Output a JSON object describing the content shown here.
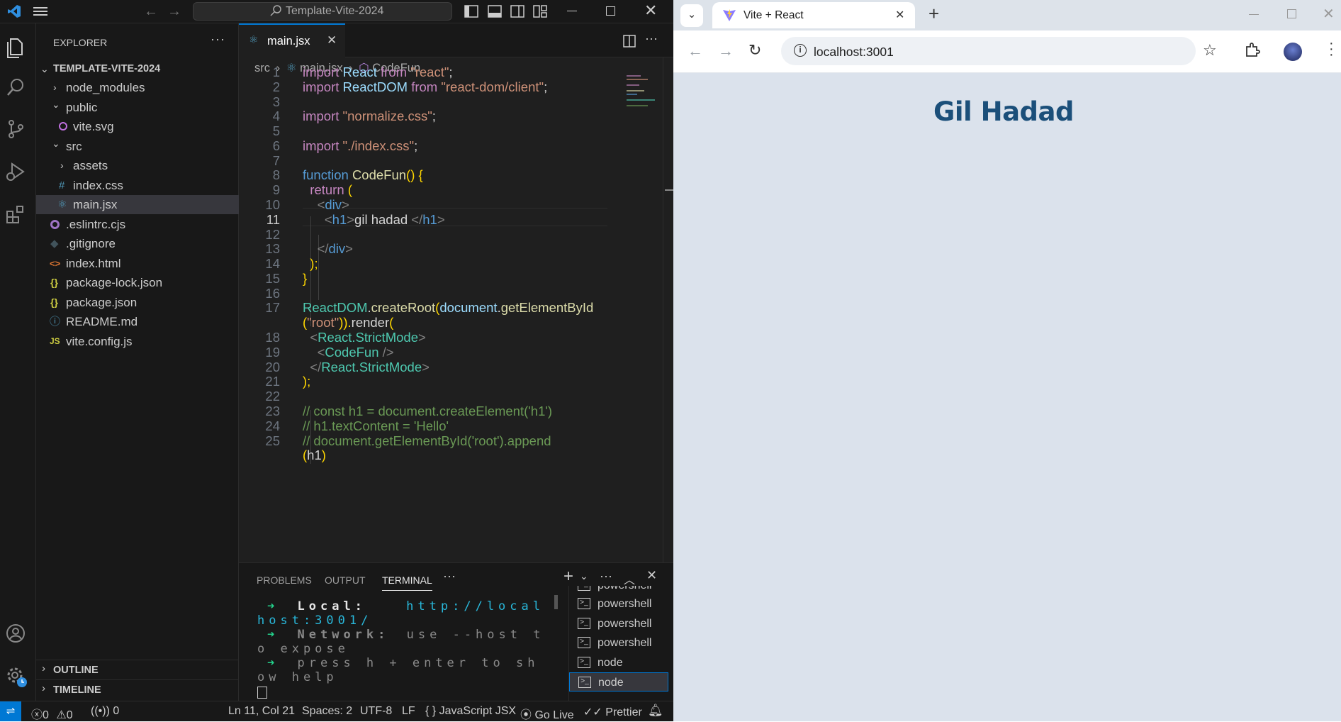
{
  "vscode": {
    "search_box": "Template-Vite-2024",
    "explorer": {
      "title": "EXPLORER",
      "project": "TEMPLATE-VITE-2024",
      "items": [
        {
          "label": "node_modules",
          "icon": "chevron-right-icon"
        },
        {
          "label": "public",
          "icon": "chevron-down-icon"
        },
        {
          "label": "vite.svg",
          "icon": "svg-file-icon"
        },
        {
          "label": "src",
          "icon": "chevron-down-icon"
        },
        {
          "label": "assets",
          "icon": "chevron-right-icon"
        },
        {
          "label": "index.css",
          "icon": "css-file-icon",
          "glyph": "#"
        },
        {
          "label": "main.jsx",
          "icon": "react-file-icon",
          "selected": true
        },
        {
          "label": ".eslintrc.cjs",
          "icon": "eslint-file-icon"
        },
        {
          "label": ".gitignore",
          "icon": "git-file-icon"
        },
        {
          "label": "index.html",
          "icon": "html-file-icon",
          "glyph": "<>"
        },
        {
          "label": "package-lock.json",
          "icon": "json-file-icon",
          "glyph": "{}"
        },
        {
          "label": "package.json",
          "icon": "json-file-icon",
          "glyph": "{}"
        },
        {
          "label": "README.md",
          "icon": "info-file-icon",
          "glyph": "ⓘ"
        },
        {
          "label": "vite.config.js",
          "icon": "js-file-icon",
          "glyph": "JS"
        }
      ],
      "outline": "OUTLINE",
      "timeline": "TIMELINE"
    },
    "tab": {
      "label": "main.jsx"
    },
    "breadcrumb": {
      "src": "src",
      "file": "main.jsx",
      "symbol": "CodeFun"
    },
    "code": [
      {
        "n": "1",
        "text": "import React from \"react\";"
      },
      {
        "n": "2",
        "text": "import ReactDOM from \"react-dom/client\";"
      },
      {
        "n": "3",
        "text": ""
      },
      {
        "n": "4",
        "text": "import \"normalize.css\";"
      },
      {
        "n": "5",
        "text": ""
      },
      {
        "n": "6",
        "text": "import \"./index.css\";"
      },
      {
        "n": "7",
        "text": ""
      },
      {
        "n": "8",
        "text": "function CodeFun() {"
      },
      {
        "n": "9",
        "text": "  return ("
      },
      {
        "n": "10",
        "text": "    <div>"
      },
      {
        "n": "11",
        "text": "      <h1>gil hadad </h1>"
      },
      {
        "n": "12",
        "text": ""
      },
      {
        "n": "13",
        "text": "    </div>"
      },
      {
        "n": "14",
        "text": "  );"
      },
      {
        "n": "15",
        "text": "}"
      },
      {
        "n": "16",
        "text": ""
      },
      {
        "n": "17",
        "text": "ReactDOM.createRoot(document.getElementById"
      },
      {
        "n": "",
        "text": "(\"root\")).render("
      },
      {
        "n": "18",
        "text": "  <React.StrictMode>"
      },
      {
        "n": "19",
        "text": "    <CodeFun />"
      },
      {
        "n": "20",
        "text": "  </React.StrictMode>"
      },
      {
        "n": "21",
        "text": ");"
      },
      {
        "n": "22",
        "text": ""
      },
      {
        "n": "23",
        "text": "// const h1 = document.createElement('h1')"
      },
      {
        "n": "24",
        "text": "// h1.textContent = 'Hello'"
      },
      {
        "n": "25",
        "text": "// document.getElementById('root').append"
      },
      {
        "n": "",
        "text": "(h1)"
      }
    ],
    "panel": {
      "tabs": [
        "PROBLEMS",
        "OUTPUT",
        "TERMINAL"
      ],
      "active_tab": "TERMINAL",
      "terminal_lines": [
        {
          "arrow": "➜",
          "label": "Local:",
          "value": "http://local"
        },
        {
          "arrow": "",
          "label": "",
          "value": "host:3001/"
        },
        {
          "arrow": "➜",
          "label": "Network:",
          "value": "use --host t"
        },
        {
          "arrow": "",
          "label": "",
          "value": "o expose"
        },
        {
          "arrow": "➜",
          "label": "",
          "value": "press h + enter to sh"
        },
        {
          "arrow": "",
          "label": "",
          "value": "ow help"
        }
      ],
      "terminals": [
        "powershell",
        "powershell",
        "powershell",
        "powershell",
        "node",
        "node"
      ]
    },
    "statusbar": {
      "errors": "0",
      "warnings": "0",
      "ports": "0",
      "position": "Ln 11, Col 21",
      "spaces": "Spaces: 2",
      "encoding": "UTF-8",
      "eol": "LF",
      "language": "JavaScript JSX",
      "golive": "Go Live",
      "prettier": "Prettier"
    }
  },
  "browser": {
    "tab_title": "Vite + React",
    "url": "localhost:3001",
    "page_heading": "Gil Hadad",
    "heading_color": "#1b4f7a"
  }
}
